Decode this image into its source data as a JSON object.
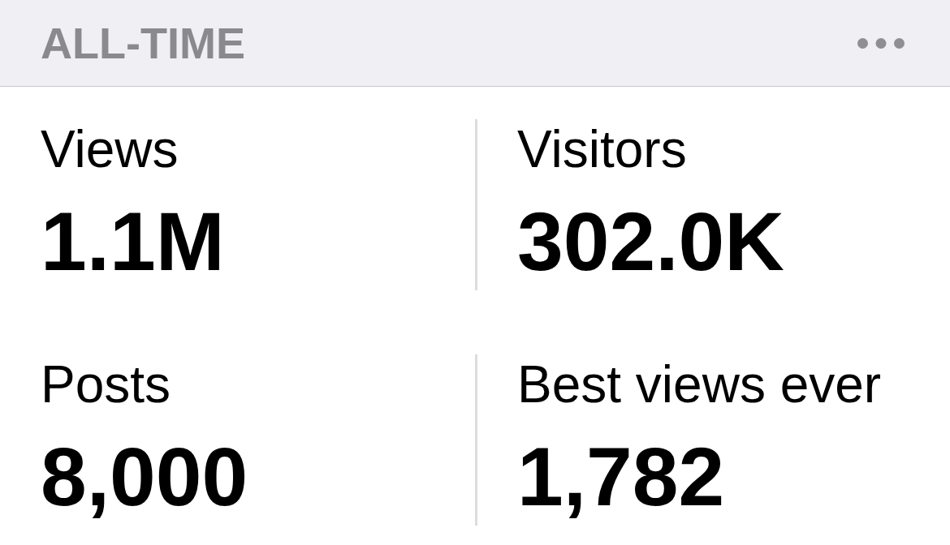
{
  "header": {
    "title": "ALL-TIME"
  },
  "stats": [
    {
      "label": "Views",
      "value": "1.1M"
    },
    {
      "label": "Visitors",
      "value": "302.0K"
    },
    {
      "label": "Posts",
      "value": "8,000"
    },
    {
      "label": "Best views ever",
      "value": "1,782"
    }
  ]
}
